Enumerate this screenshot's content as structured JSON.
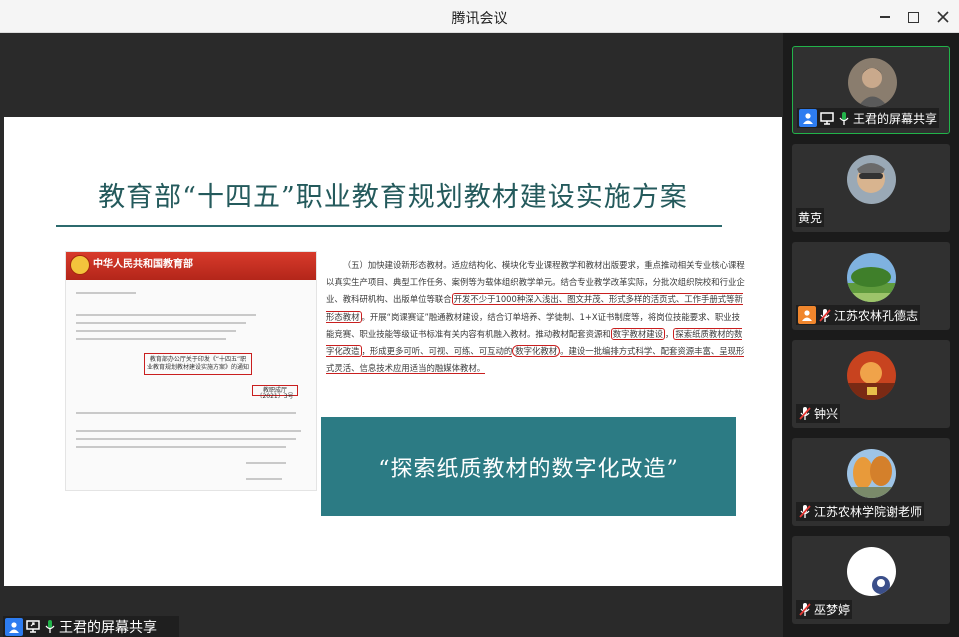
{
  "window": {
    "title": "腾讯会议"
  },
  "slide": {
    "title": "教育部“十四五”职业教育规划教材建设实施方案",
    "doc_thumbnail": {
      "org_name": "中华人民共和国教育部",
      "boxed_title": "教育部办公厅关于印发《“十四五”职业教育规划教材建设实施方案》的通知",
      "boxed_number": "教职成厅〔2021〕3号"
    },
    "paragraph": {
      "p1": "（五）加快建设新形态教材。适应结构化、模块化专业课程教学和教材出版要求，重点推动相关专业核心课程以真实生产项目、典型工作任务、案例等为载体组织教学单元。结合专业教学改革实际，分批次组织院校和行业企业、教科研机构、出版单位等联合",
      "h1": "开发不少于1000种深入浅出、图文并茂、形式多样的活页式、工作手册式等新形态教材",
      "p2": "。开展“岗课赛证”融通教材建设，结合订单培养、学徒制、1+X证书制度等，将岗位技能要求、职业技能竞赛、职业技能等级证书标准有关内容有机融入教材。推动教材配套资源和",
      "h2": "数字教材建设",
      "p3": "，",
      "h3": "探索纸质教材的数字化改造",
      "p4": "，形成更多可听、可视、可练、可互动的",
      "h4": "数字化教材",
      "p5": "。建设一批编排方式科学、配套资源丰富、呈现形式灵活、信息技术应用适当的融媒体教材。"
    },
    "quote": "“探索纸质教材的数字化改造”"
  },
  "sharer_label": "王君的屏幕共享",
  "participants": [
    {
      "name": "王君的屏幕共享",
      "active": true,
      "icons": [
        "user-icon",
        "screen-share-icon",
        "mic-on-icon"
      ]
    },
    {
      "name": "黄克",
      "active": false,
      "icons": []
    },
    {
      "name": "江苏农林孔德志",
      "active": false,
      "icons": [
        "user-icon",
        "mic-muted-icon"
      ]
    },
    {
      "name": "钟兴",
      "active": false,
      "icons": [
        "mic-muted-icon"
      ]
    },
    {
      "name": "江苏农林学院谢老师",
      "active": false,
      "icons": [
        "mic-muted-icon"
      ]
    },
    {
      "name": "巫梦婷",
      "active": false,
      "icons": [
        "mic-muted-icon"
      ]
    }
  ],
  "colors": {
    "accent_green": "#22b34a",
    "user_blue": "#2d7cf0",
    "user_orange": "#f0862d",
    "mute_red": "#e53935",
    "slide_teal": "#2c7b84"
  }
}
